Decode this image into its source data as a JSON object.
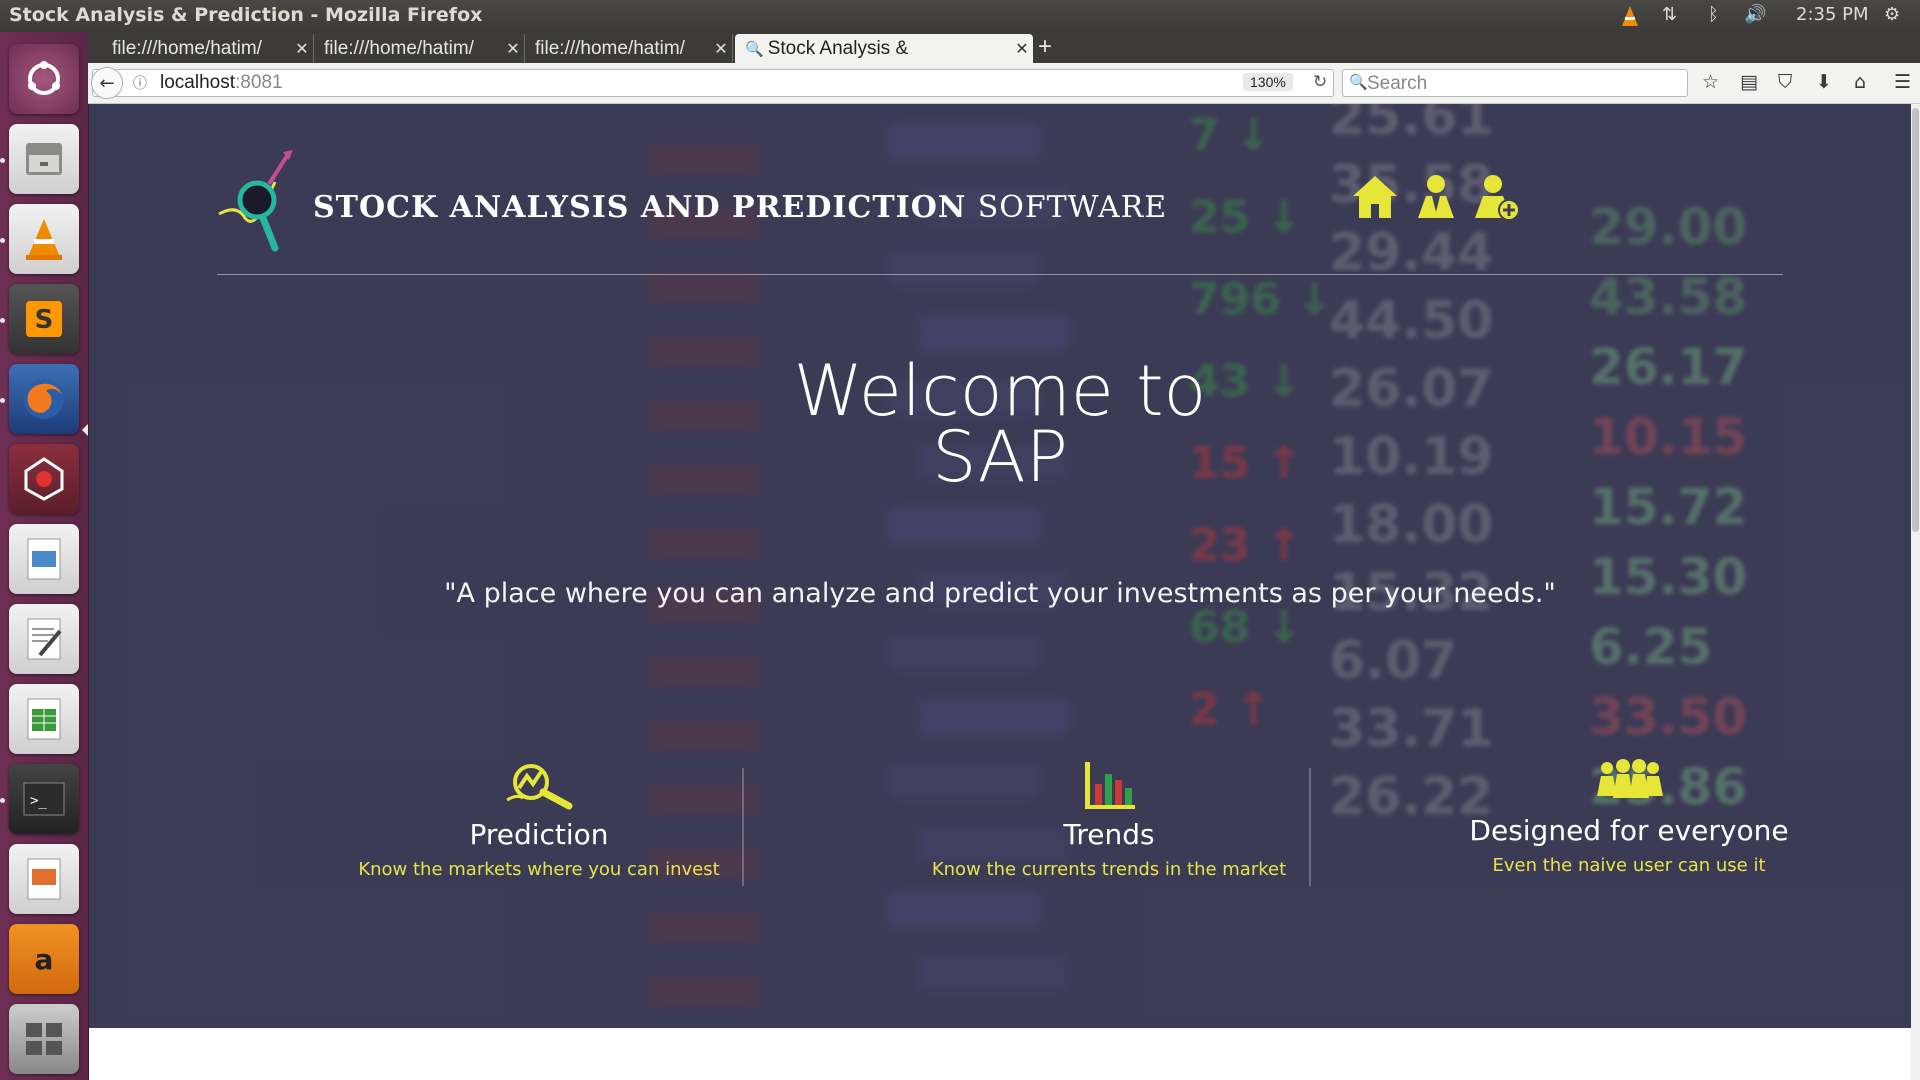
{
  "panel": {
    "window_title": "Stock Analysis & Prediction - Mozilla Firefox",
    "clock": "2:35 PM",
    "indicators": [
      "vlc-tray-icon",
      "network-icon",
      "bluetooth-icon",
      "volume-icon",
      "settings-gear-icon"
    ]
  },
  "launcher": {
    "apps": [
      "ubuntu-dash",
      "files",
      "vlc",
      "sublime-text",
      "firefox",
      "app-icon",
      "libreoffice-draw",
      "text-editor",
      "libreoffice-calc",
      "terminal",
      "libreoffice-impress",
      "amazon",
      "system-settings",
      "workspace-switcher"
    ]
  },
  "tabs": [
    {
      "label": "file:///home/hatim/",
      "active": false
    },
    {
      "label": "file:///home/hatim/",
      "active": false
    },
    {
      "label": "file:///home/hatim/",
      "active": false
    },
    {
      "label": "Stock Analysis & ",
      "active": true
    }
  ],
  "new_tab_label": "+",
  "nav": {
    "url_host": "localhost",
    "url_port": ":8081",
    "zoom": "130%",
    "search_placeholder": "Search"
  },
  "site": {
    "title_bold": "STOCK ANALYSIS AND PREDICTION",
    "title_light": "SOFTWARE",
    "header_icons": [
      "home-icon",
      "user-icon",
      "add-user-icon"
    ],
    "accent_color": "#e6e639",
    "welcome_line1": "Welcome to",
    "welcome_line2": "SAP",
    "tagline": "\"A place where you can analyze and predict your investments as per your needs.\"",
    "features": [
      {
        "title": "Prediction",
        "subtitle": "Know the markets where you can invest",
        "icon": "prediction-chart-magnifier-icon"
      },
      {
        "title": "Trends",
        "subtitle": "Know the currents trends in the market",
        "icon": "bar-chart-icon"
      },
      {
        "title": "Designed for everyone",
        "subtitle": "Even the naive user can use it",
        "icon": "people-group-icon"
      }
    ]
  },
  "background_ticker": {
    "col_prices_a": [
      "25.61",
      "35.58",
      "29.44",
      "44.50",
      "26.07",
      "10.19",
      "18.00",
      "15.32",
      "6.07",
      "33.71",
      "26.22"
    ],
    "col_prices_b": [
      "29.00",
      "43.58",
      "26.17",
      "10.15",
      "15.72",
      "15.30",
      "6.25",
      "33.50",
      "25.86"
    ],
    "col_changes": [
      "7",
      "25",
      "796",
      "43",
      "15",
      "23",
      "68",
      "2"
    ]
  }
}
